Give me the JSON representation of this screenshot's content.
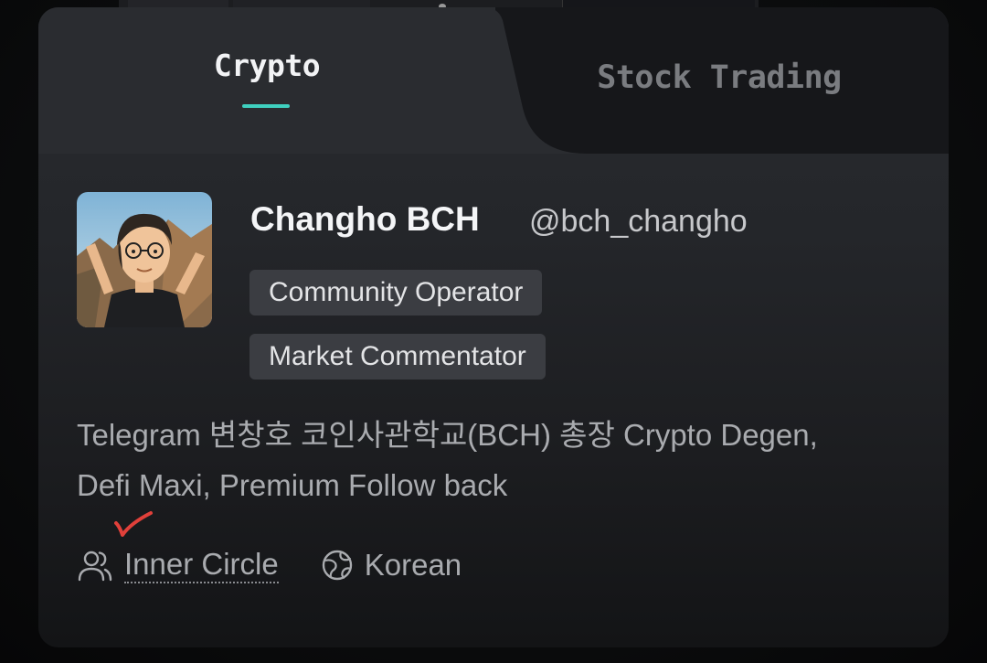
{
  "tabs": [
    {
      "label": "Crypto",
      "active": true
    },
    {
      "label": "Stock Trading",
      "active": false
    }
  ],
  "profile": {
    "name": "Changho BCH",
    "handle": "@bch_changho",
    "badges": [
      "Community Operator",
      "Market Commentator"
    ],
    "bio_line1": "Telegram 변창호 코인사관학교(BCH) 총장 Crypto Degen,",
    "bio_line2": "Defi Maxi, Premium Follow back",
    "group_label": "Inner Circle",
    "language_label": "Korean"
  },
  "colors": {
    "accent": "#3fd0bf",
    "checkmark": "#e0403a",
    "badge_bg": "#3b3d42"
  },
  "icons": {
    "group": "users-icon",
    "language": "globe-icon",
    "annotation": "red-checkmark"
  }
}
